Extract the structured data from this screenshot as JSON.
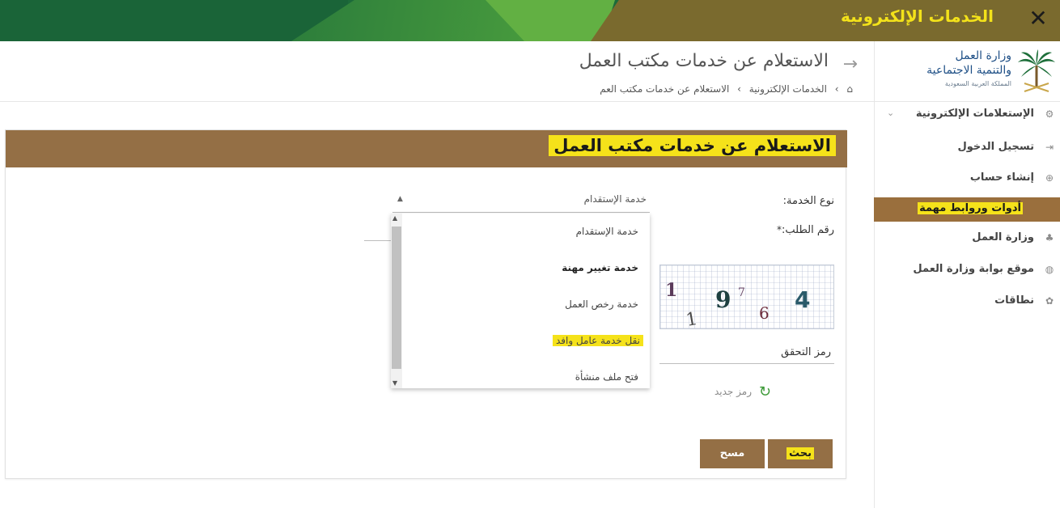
{
  "topbar": {
    "title": "الخدمات الإلكترونية"
  },
  "sidebar": {
    "ministry_line1": "وزارة العمل",
    "ministry_line2": "والتنمية الاجتماعية",
    "ministry_line3": "المملكة العربية السعودية",
    "items": [
      {
        "label": "الإستعلامات الإلكترونية",
        "icon": "cogs-icon"
      },
      {
        "label": "تسجيل الدخول",
        "icon": "sign-in-icon"
      },
      {
        "label": "إنشاء حساب",
        "icon": "plus-circle-icon"
      },
      {
        "label": "أدوات وروابط مهمة",
        "icon": ""
      },
      {
        "label": "وزارة العمل",
        "icon": "palm-icon"
      },
      {
        "label": "موقع بوابة وزارة العمل",
        "icon": "globe-icon"
      },
      {
        "label": "نطاقات",
        "icon": "gear-icon"
      }
    ]
  },
  "header": {
    "title": "الاستعلام عن خدمات مكتب العمل",
    "breadcrumb": [
      "الخدمات الإلكترونية",
      "الاستعلام عن خدمات مكتب العم"
    ]
  },
  "card": {
    "title": "الاستعلام عن خدمات مكتب العمل",
    "service_type_label": "نوع الخدمة:",
    "request_number_label": "رقم الطلب:",
    "selected_service": "خدمة الإستقدام",
    "options": [
      "خدمة الإستقدام",
      "خدمة تغيير مهنة",
      "خدمة رخص العمل",
      "نقل خدمة عامل وافد",
      "فتح ملف منشأة"
    ],
    "captcha_text": "197 6 4",
    "verification_label": "رمز التحقق",
    "new_code_label": "رمز جديد",
    "search_button": "بحث",
    "clear_button": "مسح"
  },
  "colors": {
    "green": "#1c6a3a",
    "brown": "#946f45",
    "yellow": "#f5e21a"
  }
}
